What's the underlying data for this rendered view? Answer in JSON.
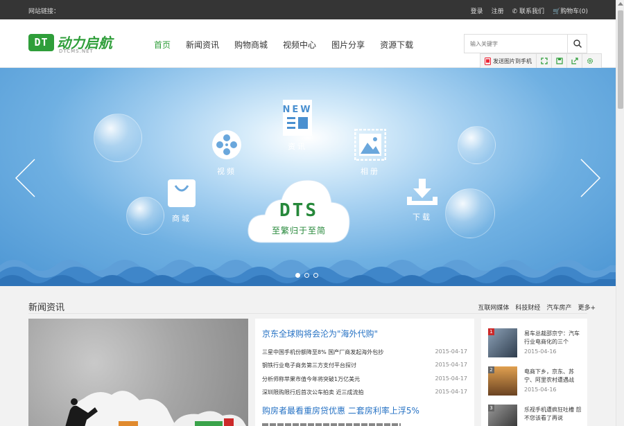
{
  "topbar": {
    "site_links": "网站链接：",
    "login": "登录",
    "register": "注册",
    "contact": "联系我们",
    "cart": "购物车(0)"
  },
  "logo": {
    "badge": "DT",
    "cn": "动力启航",
    "en": "DTCMS.NET"
  },
  "nav": [
    {
      "label": "首页",
      "active": true
    },
    {
      "label": "新闻资讯"
    },
    {
      "label": "购物商城"
    },
    {
      "label": "视频中心"
    },
    {
      "label": "图片分享"
    },
    {
      "label": "资源下载"
    }
  ],
  "search": {
    "placeholder": "输入关键字"
  },
  "sharebar": {
    "send_label": "发送图片到手机"
  },
  "banner": {
    "icons": {
      "news": {
        "label": "资讯",
        "badge": "NEW"
      },
      "video": {
        "label": "视频"
      },
      "album": {
        "label": "相册"
      },
      "shop": {
        "label": "商城"
      },
      "download": {
        "label": "下载"
      }
    },
    "brand": "DTS",
    "slogan": "至繁归于至简",
    "dots": 3,
    "active_dot": 0,
    "sky_color": "#4b95d3",
    "brand_color": "#26883a"
  },
  "news_section": {
    "title": "新闻资讯",
    "tabs": [
      "互联网媒体",
      "科技财经",
      "汽车房产",
      "更多+"
    ],
    "headline1": "京东全球购将会沦为\"海外代购\"",
    "items": [
      {
        "title": "三星中国手机份额降至8% 国产厂商发起海外包抄",
        "date": "2015-04-17"
      },
      {
        "title": "钢铁行业电子商务第三方支付平台探讨",
        "date": "2015-04-17"
      },
      {
        "title": "分析师称苹果市值今年将突破1万亿美元",
        "date": "2015-04-17"
      },
      {
        "title": "深圳限购限行后首次公车拍卖 近三成流拍",
        "date": "2015-04-17"
      }
    ],
    "headline2": "购房者最看重房贷优惠 二套房利率上浮5%",
    "side": [
      {
        "num": "1",
        "title": "易车总裁邵京宁：汽车行业电商化的三个",
        "date": "2015-04-16"
      },
      {
        "num": "2",
        "title": "电商下乡，京东、苏宁、阿里农村遭遇战",
        "date": "2015-04-16"
      },
      {
        "num": "3",
        "title": "乐视手机遭疯狂吐槽 怨不您该看了再说",
        "date": ""
      }
    ]
  }
}
